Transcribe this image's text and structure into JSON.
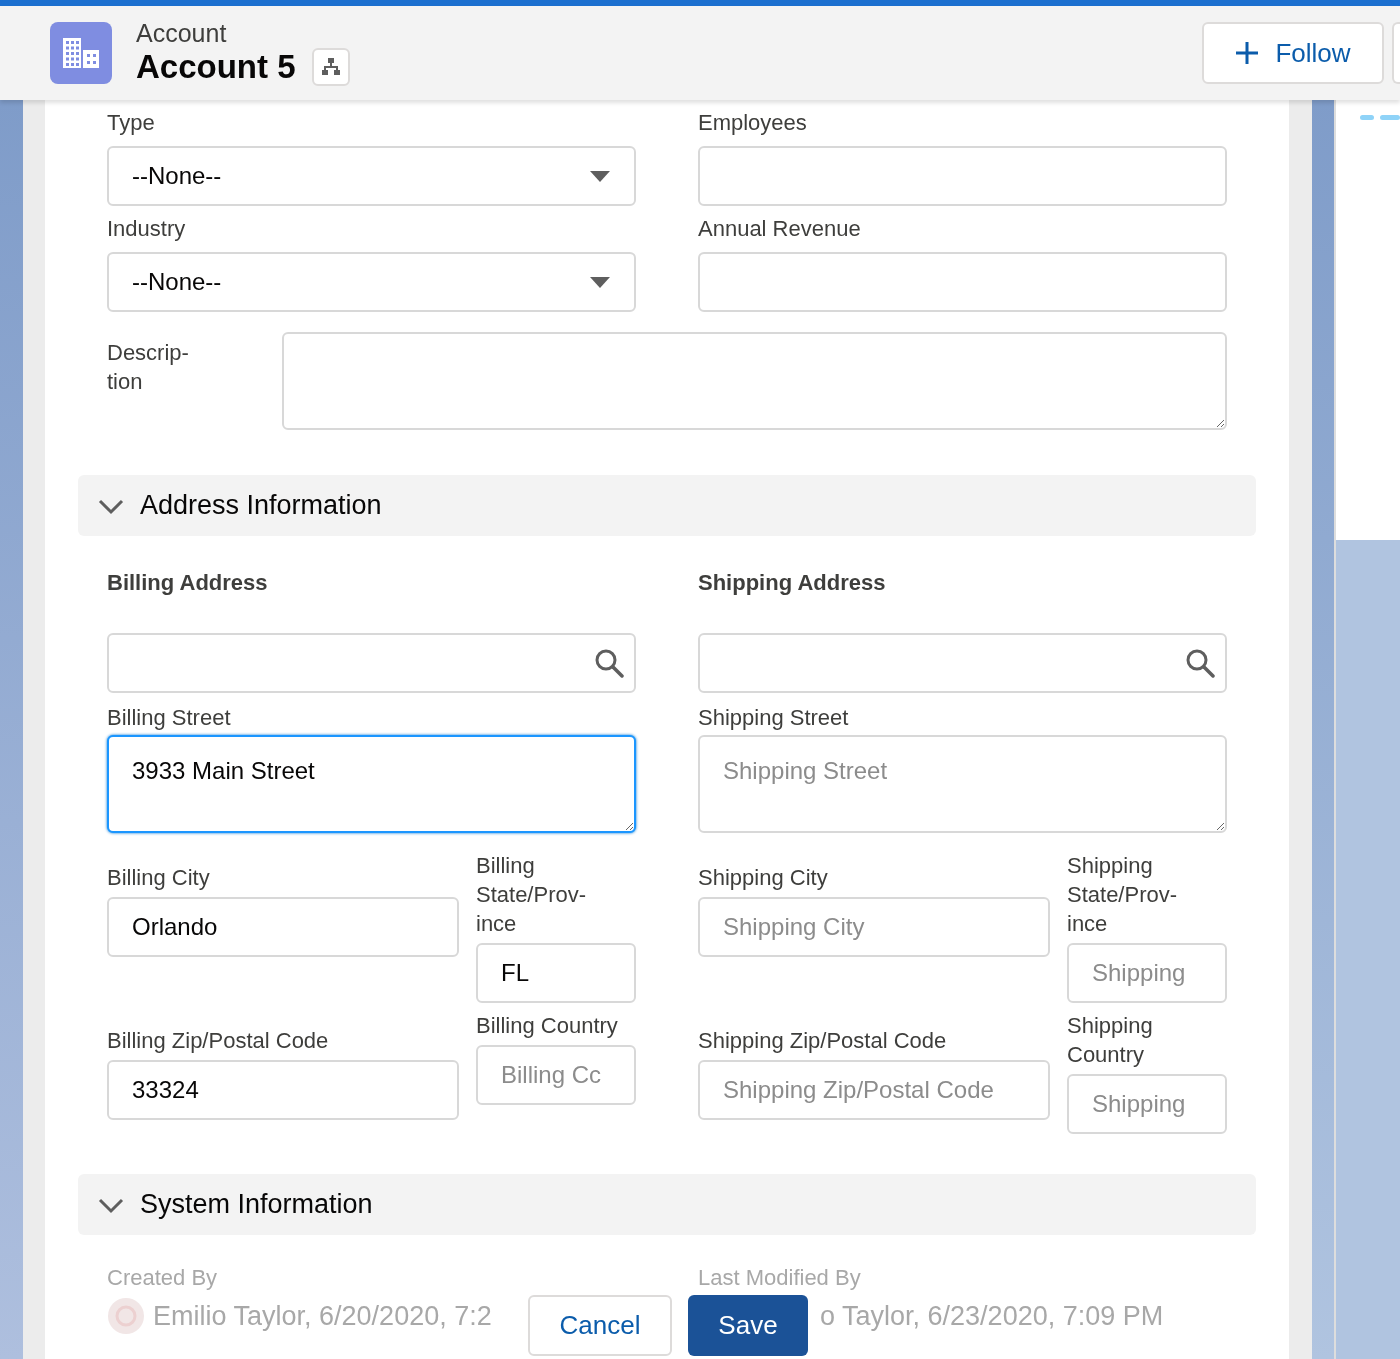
{
  "header": {
    "object_type": "Account",
    "title": "Account 5",
    "follow_button": "Follow"
  },
  "top_fields": [
    {
      "kind": "select",
      "label": "Type",
      "value": "--None--"
    },
    {
      "kind": "input",
      "label": "Employees"
    },
    {
      "kind": "select",
      "label": "Industry",
      "value": "--None--"
    },
    {
      "kind": "input",
      "label": "Annual Revenue"
    }
  ],
  "description": {
    "label": "Descrip-tion"
  },
  "address_section": {
    "title": "Address Information",
    "expanded": true
  },
  "addresses": [
    {
      "heading": "Billing Address",
      "street": {
        "label": "Billing Street",
        "value": "3933 Main Street",
        "focused": true
      },
      "city": {
        "label": "Billing City",
        "value": "Orlando"
      },
      "state": {
        "label": "Billing State/Prov-ince",
        "value": "FL"
      },
      "zip": {
        "label": "Billing Zip/Postal Code",
        "value": "33324"
      },
      "country": {
        "label": "Billing Country",
        "placeholder": "Billing Cc"
      }
    },
    {
      "heading": "Shipping Address",
      "street": {
        "label": "Shipping Street",
        "placeholder": "Shipping Street",
        "focused": false
      },
      "city": {
        "label": "Shipping City",
        "placeholder": "Shipping City"
      },
      "state": {
        "label": "Shipping State/Prov-ince",
        "placeholder": "Shipping"
      },
      "zip": {
        "label": "Shipping Zip/Postal Code",
        "placeholder": "Shipping Zip/Postal Code"
      },
      "country": {
        "label": "Shipping Country",
        "placeholder": "Shipping"
      }
    }
  ],
  "system_section": {
    "title": "System Information",
    "expanded": true
  },
  "system": {
    "created_label": "Created By",
    "created_value": "Emilio Taylor, 6/20/2020, 7:2",
    "modified_label": "Last Modified By",
    "modified_value": "o Taylor, 6/23/2020, 7:09 PM"
  },
  "buttons": {
    "cancel": "Cancel",
    "save": "Save"
  }
}
